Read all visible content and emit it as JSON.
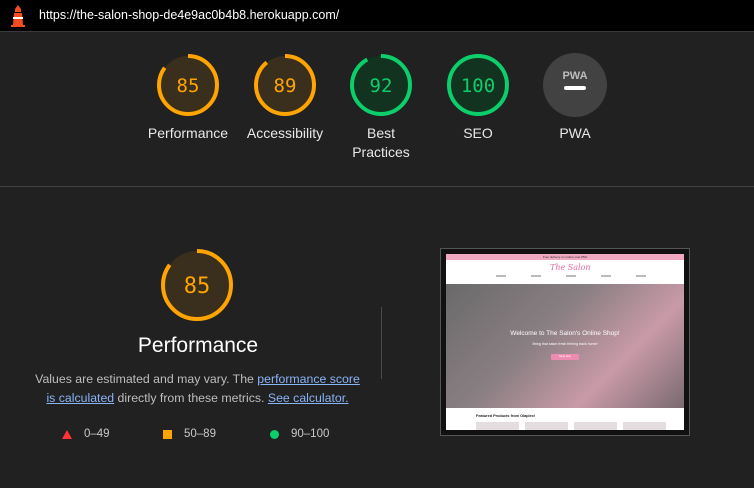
{
  "address_bar": {
    "url": "https://the-salon-shop-de4e9ac0b4b8.herokuapp.com/"
  },
  "gauges": [
    {
      "value": "85",
      "label": "Performance",
      "score": 0.85,
      "color": "#ffa400"
    },
    {
      "value": "89",
      "label": "Accessibility",
      "score": 0.89,
      "color": "#ffa400"
    },
    {
      "value": "92",
      "label": "Best Practices",
      "score": 0.92,
      "color": "#0cce6b"
    },
    {
      "value": "100",
      "label": "SEO",
      "score": 1.0,
      "color": "#0cce6b"
    },
    {
      "value": "PWA",
      "label": "PWA",
      "score": null,
      "color": "#bdbdbd"
    }
  ],
  "performance": {
    "score": "85",
    "title": "Performance",
    "desc_prefix": "Values are estimated and may vary. The ",
    "desc_link1": "performance score is calculated",
    "desc_middle": " directly from these metrics. ",
    "desc_link2": "See calculator."
  },
  "legend": [
    {
      "range": "0–49",
      "shape": "triangle",
      "color": "#ff3333"
    },
    {
      "range": "50–89",
      "shape": "square",
      "color": "#ffa400"
    },
    {
      "range": "90–100",
      "shape": "circle",
      "color": "#0cce6b"
    }
  ],
  "screenshot": {
    "promo_bar": "Free delivery on orders over €50!",
    "brand": "The Salon",
    "hero_title": "Welcome to The Salon's Online Shop!",
    "hero_subtitle": "Bring that salon fresh feeling back home!",
    "hero_button": "Shop Now",
    "featured_heading": "Featured Products from Olaplex!"
  }
}
